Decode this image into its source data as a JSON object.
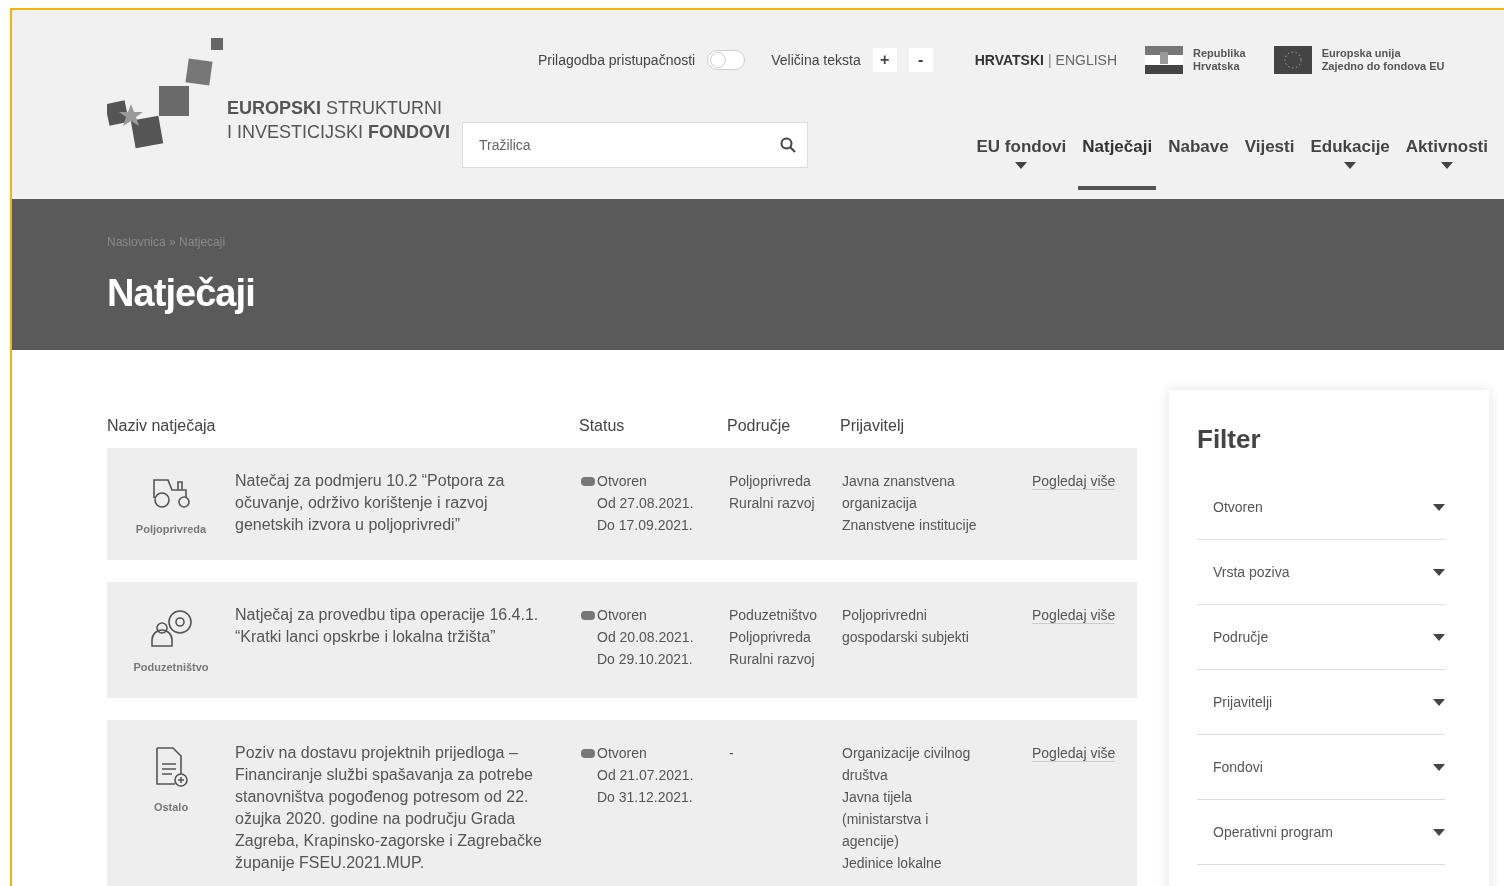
{
  "header": {
    "logo": {
      "line1_bold": "EUROPSKI",
      "line1": "STRUKTURNI",
      "line2": "I INVESTICIJSKI",
      "line2_bold": "FONDOVI"
    },
    "accessibility": {
      "label": "Prilagodba pristupačnosti",
      "on": false
    },
    "text_size": {
      "label": "Veličina teksta",
      "buttons": [
        "+",
        "-"
      ]
    },
    "languages": [
      {
        "label": "HRVATSKI",
        "selected": true
      },
      {
        "label": "ENGLISH",
        "selected": false
      }
    ],
    "language_separator": "|",
    "badges": [
      {
        "kind": "croatia",
        "lines": [
          "Republika",
          "Hrvatska"
        ]
      },
      {
        "kind": "eu",
        "lines": [
          "Europska unija",
          "Zajedno do fondova EU"
        ]
      }
    ],
    "search": {
      "placeholder": "Tražilica"
    },
    "nav": [
      {
        "label": "EU fondovi",
        "selected": false,
        "submenu": true
      },
      {
        "label": "Natječaji",
        "selected": true,
        "submenu": false
      },
      {
        "label": "Nabave",
        "selected": false,
        "submenu": false
      },
      {
        "label": "Vijesti",
        "selected": false,
        "submenu": false
      },
      {
        "label": "Edukacije",
        "selected": false,
        "submenu": true
      },
      {
        "label": "Aktivnosti",
        "selected": false,
        "submenu": true
      }
    ]
  },
  "banner": {
    "breadcrumb": "Naslovnica » Natjecaji",
    "title": "Natječaji"
  },
  "table": {
    "columns": [
      "Naziv natječaja",
      "Status",
      "Područje",
      "Prijavitelj"
    ],
    "rows": [
      {
        "kind": "tractor",
        "category": "Poljoprivreda",
        "title": "Natečaj za podmjeru 10.2 “Potpora za očuvanje, održivo korištenje i razvoj genetskih izvora u poljoprivredi”",
        "status": "Otvoren",
        "dates": [
          "Od 27.08.2021.",
          "Do 17.09.2021."
        ],
        "areas": [
          "Poljoprivreda",
          "Ruralni razvoj"
        ],
        "applicants": [
          "Javna znanstvena organizacija",
          "Znanstvene institucije"
        ],
        "link": "Pogledaj više"
      },
      {
        "kind": "person",
        "category": "Poduzetništvo",
        "title": "Natječaj za provedbu tipa operacije 16.4.1. “Kratki lanci opskrbe i lokalna tržišta”",
        "status": "Otvoren",
        "dates": [
          "Od 20.08.2021.",
          "Do 29.10.2021."
        ],
        "areas": [
          "Poduzetništvo",
          "Poljoprivreda",
          "Ruralni razvoj"
        ],
        "applicants": [
          "Poljoprivredni gospodarski subjekti"
        ],
        "link": "Pogledaj više"
      },
      {
        "kind": "document",
        "category": "Ostalo",
        "title": "Poziv na dostavu projektnih prijedloga – Financiranje službi spašavanja za potrebe stanovništva pogođenog potresom od 22. ožujka 2020. godine na području Grada Zagreba, Krapinsko-zagorske i Zagrebačke županije FSEU.2021.MUP.",
        "status": "Otvoren",
        "dates": [
          "Od 21.07.2021.",
          "Do 31.12.2021."
        ],
        "areas": [
          "-"
        ],
        "applicants": [
          "Organizacije civilnog društva",
          "Javna tijela (ministarstva i agencije)",
          "Jedinice lokalne"
        ],
        "link": "Pogledaj više"
      }
    ]
  },
  "filter": {
    "title": "Filter",
    "selects": [
      "Otvoren",
      "Vrsta poziva",
      "Područje",
      "Prijavitelji",
      "Fondovi",
      "Operativni program"
    ]
  }
}
